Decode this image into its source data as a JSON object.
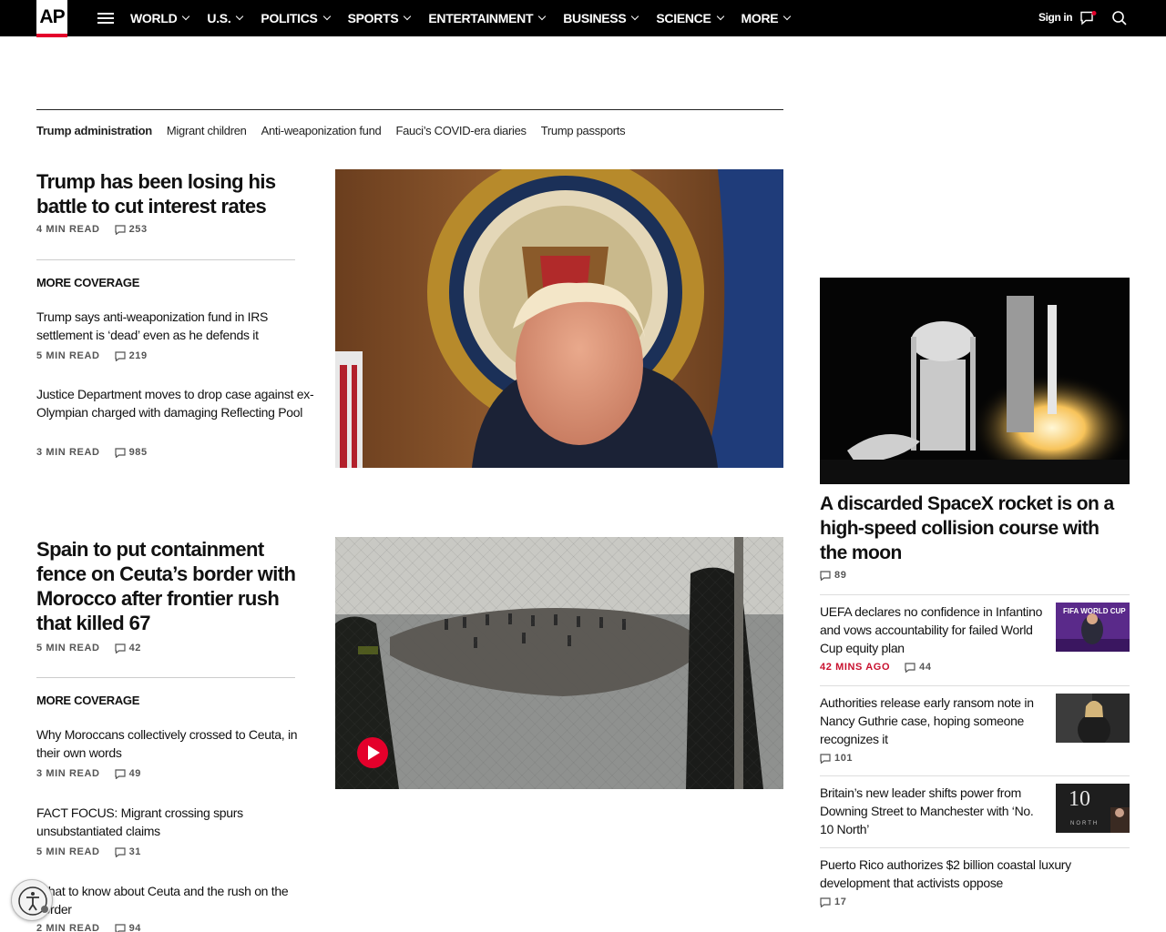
{
  "nav": {
    "logo": "AP",
    "items": [
      "WORLD",
      "U.S.",
      "POLITICS",
      "SPORTS",
      "ENTERTAINMENT",
      "BUSINESS",
      "SCIENCE",
      "MORE"
    ],
    "signin": "Sign in"
  },
  "topics": [
    "Trump administration",
    "Migrant children",
    "Anti-weaponization fund",
    "Fauci’s COVID-era diaries",
    "Trump passports"
  ],
  "story1": {
    "title": "Trump has been losing his battle to cut interest rates",
    "read": "4 MIN READ",
    "comments": "253",
    "more_label": "MORE COVERAGE",
    "related": [
      {
        "title": "Trump says anti-weaponization fund in IRS settlement is ‘dead’ even as he defends it",
        "read": "5 MIN READ",
        "comments": "219"
      },
      {
        "title": "Justice Department moves to drop case against ex-Olympian charged with damaging Reflecting Pool",
        "read": "3 MIN READ",
        "comments": "985"
      }
    ]
  },
  "story2": {
    "title": "Spain to put containment fence on Ceuta’s border with Morocco after frontier rush that killed 67",
    "read": "5 MIN READ",
    "comments": "42",
    "more_label": "MORE COVERAGE",
    "related": [
      {
        "title": "Why Moroccans collectively crossed to Ceuta, in their own words",
        "read": "3 MIN READ",
        "comments": "49"
      },
      {
        "title": "FACT FOCUS: Migrant crossing spurs unsubstantiated claims",
        "read": "5 MIN READ",
        "comments": "31"
      },
      {
        "title": "What to know about Ceuta and the rush on the border",
        "read": "2 MIN READ",
        "comments": "94"
      }
    ]
  },
  "rail": {
    "feature": {
      "title": "A discarded SpaceX rocket is on a high-speed collision course with the moon",
      "comments": "89"
    },
    "items": [
      {
        "title": "UEFA declares no confidence in Infantino and vows accountability for failed World Cup equity plan",
        "time": "42 MINS AGO",
        "comments": "44",
        "thumb_text": "FIFA WORLD CUP"
      },
      {
        "title": "Authorities release early ransom note in Nancy Guthrie case, hoping someone recognizes it",
        "comments": "101"
      },
      {
        "title": "Britain’s new leader shifts power from Downing Street to Manchester with ‘No. 10 North’",
        "thumb_text": "10",
        "thumb_sub": "NORTH"
      },
      {
        "title": "Puerto Rico authorizes $2 billion coastal luxury development that activists oppose",
        "comments": "17"
      }
    ]
  },
  "colors": {
    "accent_red": "#c8102e",
    "nav_bg": "#000000"
  }
}
